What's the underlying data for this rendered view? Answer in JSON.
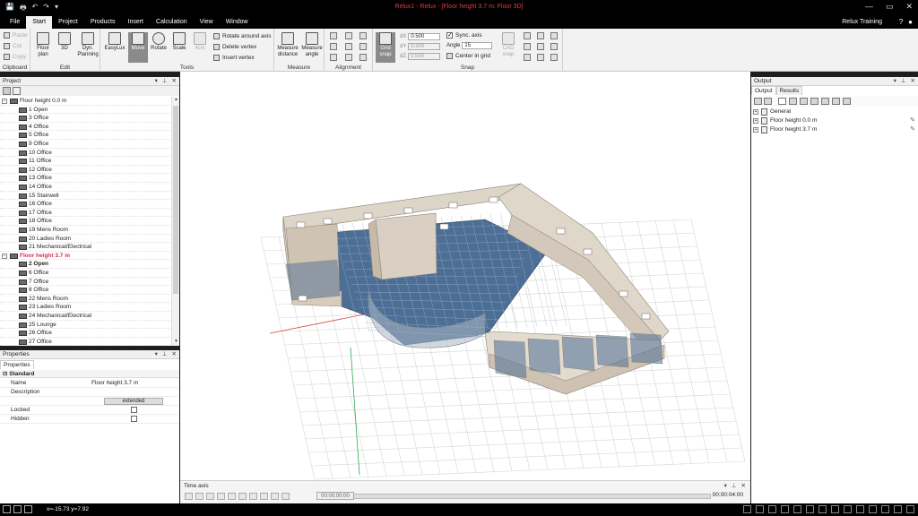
{
  "window": {
    "title": "Relux1 - Relux - [Floor height 3.7 m: Floor 3D]",
    "quick_access": [
      "💾",
      "🖶",
      "↶",
      "↷",
      "▾"
    ],
    "controls": [
      "—",
      "▭",
      "✕"
    ]
  },
  "menu": {
    "tabs": [
      "File",
      "Start",
      "Project",
      "Products",
      "Insert",
      "Calculation",
      "View",
      "Window"
    ],
    "active_tab": "Start",
    "user": "Relux Training",
    "help_icons": [
      "?",
      "●"
    ]
  },
  "ribbon": {
    "clipboard": {
      "label": "Clipboard",
      "paste": "Paste",
      "cut": "Cut",
      "copy": "Copy"
    },
    "edit": {
      "label": "Edit",
      "floor_plan": "Floor plan",
      "view3d": "3D",
      "dyn_planning": "Dyn. Planning"
    },
    "tools": {
      "label": "Tools",
      "easylux": "EasyLux",
      "move": "Move",
      "rotate": "Rotate",
      "scale": "Scale",
      "qm": "4cm",
      "rotate_axis": "Rotate around axis",
      "delete_vertex": "Delete vertex",
      "insert_vertex": "Insert vertex"
    },
    "measure": {
      "label": "Measure",
      "distance": "Measure distance",
      "angle": "Measure angle"
    },
    "alignment": {
      "label": "Alignment"
    },
    "snap": {
      "label": "Snap",
      "grid_snap": "Grid snap",
      "cad_snap": "CAD snap",
      "dx_label": "dX",
      "dx_value": "0.500",
      "dy_label": "dY",
      "dy_value": "0.500",
      "dz_label": "dZ",
      "dz_value": "0.500",
      "sync_axis": "Sync. axis",
      "angle_label": "Angle",
      "angle_value": "15",
      "center_in_grid": "Center in grid"
    }
  },
  "project": {
    "header": "Project",
    "tree": [
      {
        "type": "floor",
        "label": "Floor height 0.0 m"
      },
      {
        "type": "room",
        "label": "1 Open"
      },
      {
        "type": "room",
        "label": "3 Office"
      },
      {
        "type": "room",
        "label": "4 Office"
      },
      {
        "type": "room",
        "label": "5 Office"
      },
      {
        "type": "room",
        "label": "9 Office"
      },
      {
        "type": "room",
        "label": "10 Office"
      },
      {
        "type": "room",
        "label": "11 Office"
      },
      {
        "type": "room",
        "label": "12 Office"
      },
      {
        "type": "room",
        "label": "13 Office"
      },
      {
        "type": "room",
        "label": "14 Office"
      },
      {
        "type": "room",
        "label": "15 Stairwell"
      },
      {
        "type": "room",
        "label": "16 Office"
      },
      {
        "type": "room",
        "label": "17 Office"
      },
      {
        "type": "room",
        "label": "18 Office"
      },
      {
        "type": "room",
        "label": "19 Mens Room"
      },
      {
        "type": "room",
        "label": "20 Ladies Room"
      },
      {
        "type": "room",
        "label": "21 Mechanical/Electrical"
      },
      {
        "type": "floor",
        "label": "Floor height 3.7 m",
        "active": true
      },
      {
        "type": "room",
        "label": "2 Open",
        "bold": true
      },
      {
        "type": "room",
        "label": "6 Office"
      },
      {
        "type": "room",
        "label": "7 Office"
      },
      {
        "type": "room",
        "label": "8 Office"
      },
      {
        "type": "room",
        "label": "22 Mens Room"
      },
      {
        "type": "room",
        "label": "23 Ladies Room"
      },
      {
        "type": "room",
        "label": "24 Mechanical/Electrical"
      },
      {
        "type": "room",
        "label": "25 Lounge"
      },
      {
        "type": "room",
        "label": "26 Office"
      },
      {
        "type": "room",
        "label": "27 Office"
      }
    ]
  },
  "properties": {
    "header": "Properties",
    "tab": "Properties",
    "section": "Standard",
    "name_label": "Name",
    "name_value": "Floor height 3.7 m",
    "description_label": "Description",
    "description_button": "extended",
    "locked_label": "Locked",
    "hidden_label": "Hidden"
  },
  "timeaxis": {
    "header": "Time axis",
    "start": "00:00:00:00",
    "end": "00:00:04:00"
  },
  "output": {
    "header": "Output",
    "tabs": [
      "Output",
      "Results"
    ],
    "active_tab": "Output",
    "items": [
      "General",
      "Floor height 0.0 m",
      "Floor height 3.7 m"
    ]
  },
  "status": {
    "coords": "x=-15.73 y=7.92"
  },
  "colors": {
    "active_floor": "#d0344c",
    "titlebar_text": "#e23b3b",
    "wall": "#d9d0c4",
    "floor_tile": "#4d6f96"
  }
}
